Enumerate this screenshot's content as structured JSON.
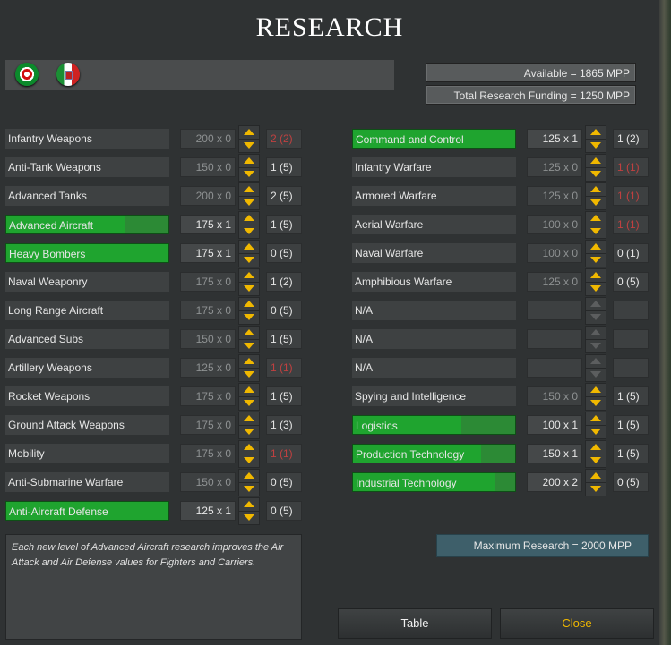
{
  "title": "RESEARCH",
  "flags": [
    {
      "icon": "portugal-roundel-icon"
    },
    {
      "icon": "italy-flag-icon"
    }
  ],
  "available": "Available =  1865 MPP",
  "funding": "Total Research Funding =  1250 MPP",
  "left_rows": [
    {
      "label": "Infantry Weapons",
      "cost": "200 x 0",
      "level": "2 (2)",
      "progress": 0,
      "active": false,
      "maxed": true
    },
    {
      "label": "Anti-Tank Weapons",
      "cost": "150 x 0",
      "level": "1 (5)",
      "progress": 0,
      "active": false,
      "maxed": false
    },
    {
      "label": "Advanced Tanks",
      "cost": "200 x 0",
      "level": "2 (5)",
      "progress": 0,
      "active": false,
      "maxed": false
    },
    {
      "label": "Advanced Aircraft",
      "cost": "175 x 1",
      "level": "1 (5)",
      "progress": 0.73,
      "active": true,
      "maxed": false
    },
    {
      "label": "Heavy Bombers",
      "cost": "175 x 1",
      "level": "0 (5)",
      "progress": 1.0,
      "active": true,
      "maxed": false
    },
    {
      "label": "Naval Weaponry",
      "cost": "175 x 0",
      "level": "1 (2)",
      "progress": 0,
      "active": false,
      "maxed": false
    },
    {
      "label": "Long Range Aircraft",
      "cost": "175 x 0",
      "level": "0 (5)",
      "progress": 0,
      "active": false,
      "maxed": false
    },
    {
      "label": "Advanced Subs",
      "cost": "150 x 0",
      "level": "1 (5)",
      "progress": 0,
      "active": false,
      "maxed": false
    },
    {
      "label": "Artillery Weapons",
      "cost": "125 x 0",
      "level": "1 (1)",
      "progress": 0,
      "active": false,
      "maxed": true
    },
    {
      "label": "Rocket Weapons",
      "cost": "175 x 0",
      "level": "1 (5)",
      "progress": 0,
      "active": false,
      "maxed": false
    },
    {
      "label": "Ground Attack Weapons",
      "cost": "175 x 0",
      "level": "1 (3)",
      "progress": 0,
      "active": false,
      "maxed": false
    },
    {
      "label": "Mobility",
      "cost": "175 x 0",
      "level": "1 (1)",
      "progress": 0,
      "active": false,
      "maxed": true
    },
    {
      "label": "Anti-Submarine Warfare",
      "cost": "150 x 0",
      "level": "0 (5)",
      "progress": 0,
      "active": false,
      "maxed": false
    },
    {
      "label": "Anti-Aircraft Defense",
      "cost": "125 x 1",
      "level": "0 (5)",
      "progress": 1.0,
      "active": true,
      "maxed": false
    }
  ],
  "right_rows": [
    {
      "label": "Command and Control",
      "cost": "125 x 1",
      "level": "1 (2)",
      "progress": 1.0,
      "active": true,
      "maxed": false
    },
    {
      "label": "Infantry Warfare",
      "cost": "125 x 0",
      "level": "1 (1)",
      "progress": 0,
      "active": false,
      "maxed": true
    },
    {
      "label": "Armored Warfare",
      "cost": "125 x 0",
      "level": "1 (1)",
      "progress": 0,
      "active": false,
      "maxed": true
    },
    {
      "label": "Aerial Warfare",
      "cost": "100 x 0",
      "level": "1 (1)",
      "progress": 0,
      "active": false,
      "maxed": true
    },
    {
      "label": "Naval Warfare",
      "cost": "100 x 0",
      "level": "0 (1)",
      "progress": 0,
      "active": false,
      "maxed": false
    },
    {
      "label": "Amphibious Warfare",
      "cost": "125 x 0",
      "level": "0 (5)",
      "progress": 0,
      "active": false,
      "maxed": false
    },
    {
      "label": "N/A",
      "cost": "",
      "level": "",
      "progress": 0,
      "active": false,
      "maxed": false,
      "empty": true
    },
    {
      "label": "N/A",
      "cost": "",
      "level": "",
      "progress": 0,
      "active": false,
      "maxed": false,
      "empty": true
    },
    {
      "label": "N/A",
      "cost": "",
      "level": "",
      "progress": 0,
      "active": false,
      "maxed": false,
      "empty": true
    },
    {
      "label": "Spying and Intelligence",
      "cost": "150 x 0",
      "level": "1 (5)",
      "progress": 0,
      "active": false,
      "maxed": false
    },
    {
      "label": "Logistics",
      "cost": "100 x 1",
      "level": "1 (5)",
      "progress": 0.67,
      "active": true,
      "maxed": false
    },
    {
      "label": "Production Technology",
      "cost": "150 x 1",
      "level": "1 (5)",
      "progress": 0.79,
      "active": true,
      "maxed": false
    },
    {
      "label": "Industrial Technology",
      "cost": "200 x 2",
      "level": "0 (5)",
      "progress": 0.88,
      "active": true,
      "maxed": false
    }
  ],
  "description": "Each new level of Advanced Aircraft research improves the Air Attack and Air Defense values for Fighters and Carriers.",
  "max_research": "Maximum Research =  2000 MPP",
  "buttons": {
    "table": "Table",
    "close": "Close"
  },
  "colors": {
    "progress_fill": "#1fa42f",
    "spinner_arrow": "#f0b800",
    "maxed_level": "#c04040",
    "close_text": "#f0b800"
  }
}
